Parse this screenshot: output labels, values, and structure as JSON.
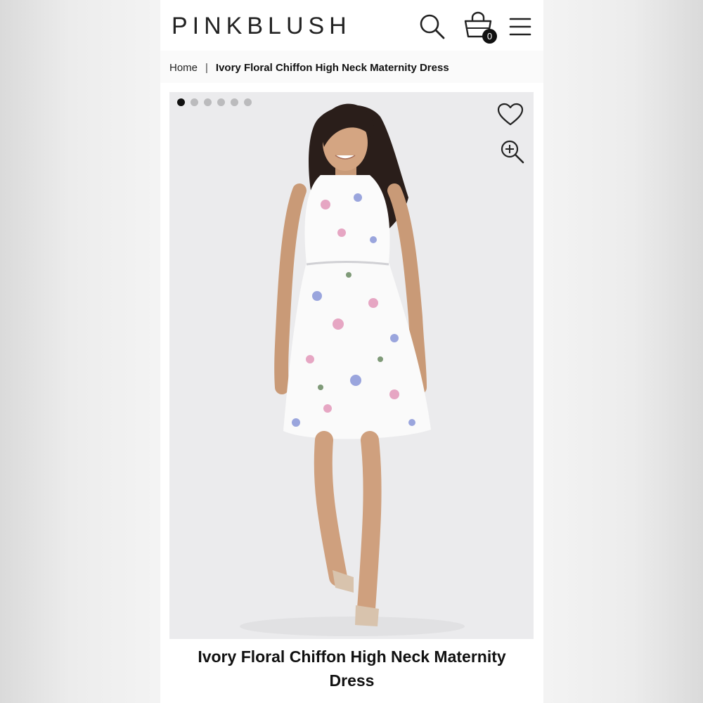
{
  "header": {
    "logo": "PINKBLUSH",
    "cart_count": "0",
    "icons": [
      "search-icon",
      "shopping-bag-icon",
      "hamburger-menu-icon"
    ]
  },
  "breadcrumb": {
    "home": "Home",
    "separator": "|",
    "current": "Ivory Floral Chiffon High Neck Maternity Dress"
  },
  "gallery": {
    "image_count": 6,
    "active_index": 0,
    "icons": [
      "heart-icon",
      "zoom-in-icon"
    ]
  },
  "product": {
    "title": "Ivory Floral Chiffon High Neck Maternity Dress"
  },
  "colors": {
    "accent": "#111111",
    "background": "#f3f3f3",
    "image_bg": "#ebebed"
  }
}
